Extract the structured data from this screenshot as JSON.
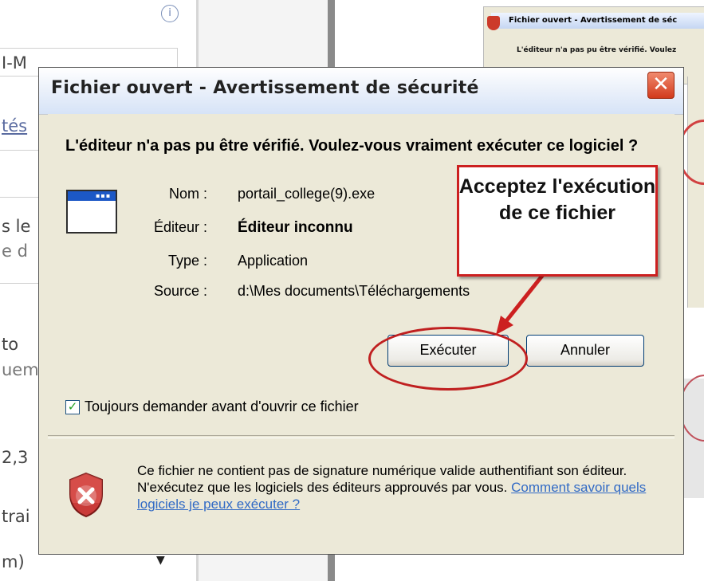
{
  "background": {
    "left_fragments": [
      "I-M",
      "tés",
      "s le",
      "e d",
      "to",
      "uem",
      "2,3",
      "trai",
      "m)"
    ],
    "thumbnail_title": "Fichier ouvert - Avertissement de séc",
    "thumbnail_text": "L'éditeur n'a pas pu être vérifié. Voulez"
  },
  "dialog": {
    "title": "Fichier ouvert - Avertissement de sécurité",
    "close_glyph": "✕",
    "heading": "L'éditeur n'a pas pu être vérifié. Voulez-vous vraiment exécuter ce logiciel ?",
    "fields": [
      {
        "label": "Nom :",
        "value": "portail_college(9).exe"
      },
      {
        "label": "Éditeur :",
        "value": "Éditeur inconnu"
      },
      {
        "label": "Type :",
        "value": "Application"
      },
      {
        "label": "Source :",
        "value": "d:\\Mes documents\\Téléchargements"
      }
    ],
    "run_button": "Exécuter",
    "cancel_button": "Annuler",
    "checkbox_label": "Toujours demander avant d'ouvrir ce fichier",
    "checkbox_checked": true,
    "warning_text": "Ce fichier ne contient pas de signature numérique valide authentifiant son éditeur. N'exécutez que les logiciels des éditeurs approuvés par vous.",
    "warning_link": "Comment savoir quels logiciels je peux exécuter ?"
  },
  "callout": {
    "text": "Acceptez l'exécution de ce fichier"
  },
  "colors": {
    "callout_border": "#cc2020",
    "close_button": "#d23a1c",
    "link": "#316ac5",
    "checkbox_check": "#21a121"
  }
}
